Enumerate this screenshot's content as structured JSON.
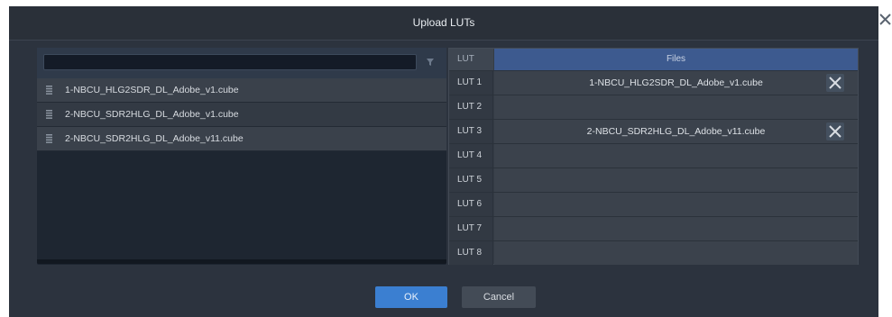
{
  "dialog": {
    "title": "Upload LUTs"
  },
  "filter": {
    "value": "",
    "placeholder": ""
  },
  "files": [
    {
      "name": "1-NBCU_HLG2SDR_DL_Adobe_v1.cube"
    },
    {
      "name": "2-NBCU_SDR2HLG_DL_Adobe_v1.cube"
    },
    {
      "name": "2-NBCU_SDR2HLG_DL_Adobe_v11.cube"
    }
  ],
  "lut_table": {
    "header_lut": "LUT",
    "header_files": "Files",
    "rows": [
      {
        "label": "LUT 1",
        "file": "1-NBCU_HLG2SDR_DL_Adobe_v1.cube"
      },
      {
        "label": "LUT 2",
        "file": ""
      },
      {
        "label": "LUT 3",
        "file": "2-NBCU_SDR2HLG_DL_Adobe_v11.cube"
      },
      {
        "label": "LUT 4",
        "file": ""
      },
      {
        "label": "LUT 5",
        "file": ""
      },
      {
        "label": "LUT 6",
        "file": ""
      },
      {
        "label": "LUT 7",
        "file": ""
      },
      {
        "label": "LUT 8",
        "file": ""
      }
    ]
  },
  "buttons": {
    "ok": "OK",
    "cancel": "Cancel"
  },
  "colors": {
    "accent": "#3b7fd1",
    "header_files_bg": "#3d5a8f",
    "dialog_bg": "#2c333e"
  }
}
